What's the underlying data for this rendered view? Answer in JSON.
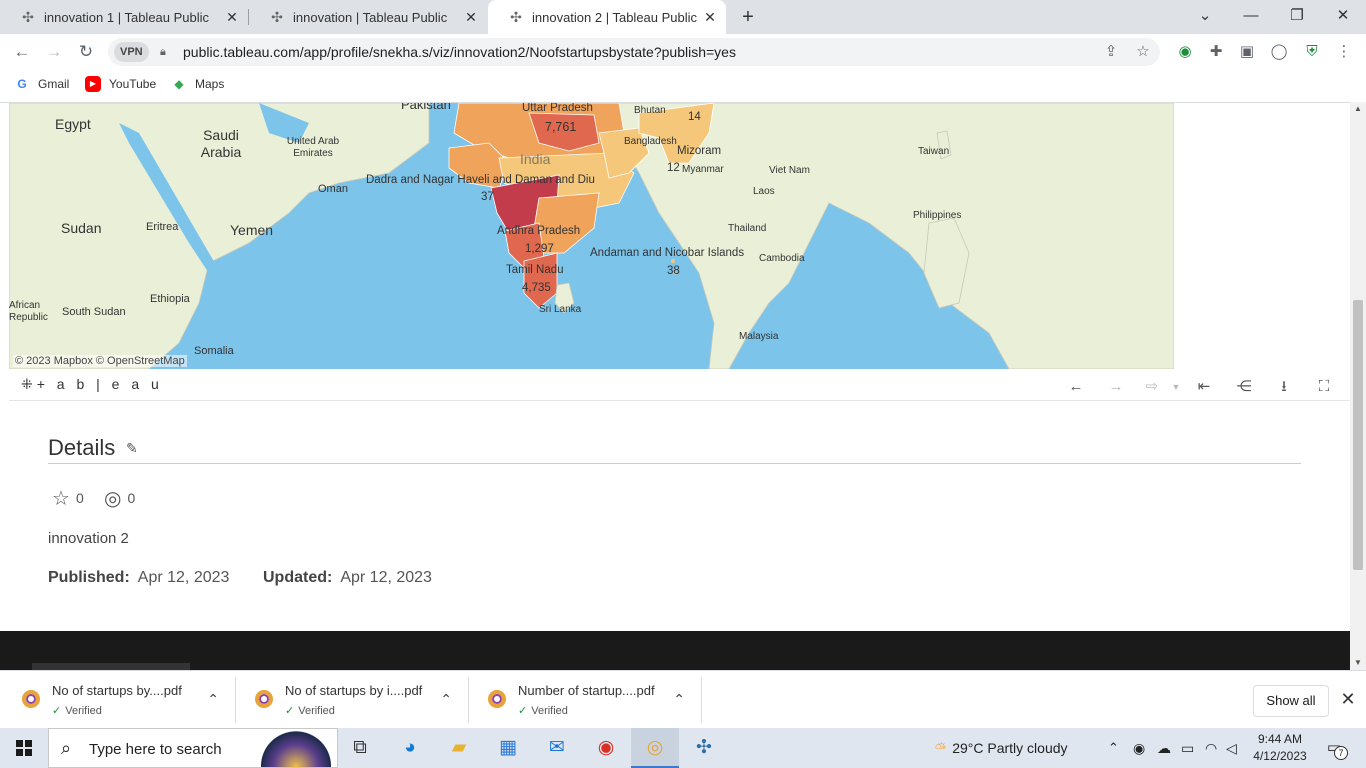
{
  "browser": {
    "tabs": [
      {
        "title": "innovation 1 | Tableau Public",
        "active": false
      },
      {
        "title": "innovation | Tableau Public",
        "active": false
      },
      {
        "title": "innovation 2 | Tableau Public",
        "active": true
      }
    ],
    "new_tab_icon": "plus-icon",
    "url": "public.tableau.com/app/profile/snekha.s/viz/innovation2/Noofstartupsbystate?publish=yes",
    "vpn_label": "VPN",
    "bookmarks": [
      {
        "label": "Gmail",
        "icon": "G",
        "color": "#4285f4"
      },
      {
        "label": "YouTube",
        "icon": "▶",
        "color": "#ff0000"
      },
      {
        "label": "Maps",
        "icon": "◆",
        "color": "#34a853"
      }
    ]
  },
  "map": {
    "countries": [
      "Egypt",
      "Saudi Arabia",
      "Sudan",
      "Yemen",
      "India"
    ],
    "places": [
      "Pakistan",
      "United Arab Emirates",
      "Oman",
      "Eritrea",
      "Ethiopia",
      "African Republic",
      "South Sudan",
      "Somalia",
      "Bhutan",
      "Bangladesh",
      "Myanmar",
      "Laos",
      "Viet Nam",
      "Thailand",
      "Cambodia",
      "Taiwan",
      "Philippines",
      "Malaysia",
      "Sri Lanka"
    ],
    "state_values": [
      {
        "state": "Uttar Pradesh",
        "value": "7,761"
      },
      {
        "state": "",
        "value": "14"
      },
      {
        "state": "Mizoram",
        "value": "12"
      },
      {
        "state": "Dadra and Nagar Haveli and Daman and Diu",
        "value": "37"
      },
      {
        "state": "Andhra Pradesh",
        "value": "1,297"
      },
      {
        "state": "Tamil Nadu",
        "value": "4,735"
      },
      {
        "state": "Andaman and Nicobar Islands",
        "value": "38"
      }
    ],
    "attribution": "© 2023 Mapbox  © OpenStreetMap",
    "colors": {
      "sea": "#7cc4ea",
      "land": "#eaf0d8",
      "low": "#f5c77a",
      "mid": "#f0a35a",
      "high": "#e0684f",
      "top": "#c23c4c"
    }
  },
  "tableau_toolbar": {
    "logo": "+ a b | e a u",
    "buttons": [
      "undo-icon",
      "redo-icon",
      "revert-icon",
      "revert-start-icon",
      "share-icon",
      "download-icon",
      "fullscreen-icon"
    ]
  },
  "details": {
    "title": "Details",
    "favorites": "0",
    "views": "0",
    "viz_name": "innovation 2",
    "published_label": "Published:",
    "published_date": "Apr 12, 2023",
    "updated_label": "Updated:",
    "updated_date": "Apr 12, 2023"
  },
  "downloads": {
    "items": [
      {
        "name": "No of startups by....pdf",
        "status": "Verified"
      },
      {
        "name": "No of startups by i....pdf",
        "status": "Verified"
      },
      {
        "name": "Number of startup....pdf",
        "status": "Verified"
      }
    ],
    "show_all": "Show all"
  },
  "taskbar": {
    "search_placeholder": "Type here to search",
    "weather": "29°C  Partly cloudy",
    "time": "9:44 AM",
    "date": "4/12/2023",
    "notification_count": "7"
  }
}
